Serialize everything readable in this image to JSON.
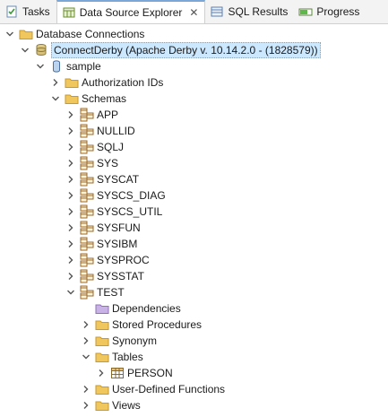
{
  "tabs": [
    {
      "label": "Tasks",
      "icon": "tasks-icon"
    },
    {
      "label": "Data Source Explorer",
      "icon": "data-source-explorer-icon",
      "active": true
    },
    {
      "label": "SQL Results",
      "icon": "sql-results-icon"
    },
    {
      "label": "Progress",
      "icon": "progress-icon"
    }
  ],
  "tree": [
    {
      "label": "Database Connections",
      "level": 0,
      "twisty": "expanded",
      "icon": "folder-icon"
    },
    {
      "label": "ConnectDerby (Apache Derby v. 10.14.2.0 - (1828579))",
      "level": 1,
      "twisty": "expanded",
      "icon": "database-icon",
      "selected": true
    },
    {
      "label": "sample",
      "level": 2,
      "twisty": "expanded",
      "icon": "database-small-icon"
    },
    {
      "label": "Authorization IDs",
      "level": 3,
      "twisty": "collapsed",
      "icon": "folder-icon"
    },
    {
      "label": "Schemas",
      "level": 3,
      "twisty": "expanded",
      "icon": "folder-icon"
    },
    {
      "label": "APP",
      "level": 4,
      "twisty": "collapsed",
      "icon": "schema-icon"
    },
    {
      "label": "NULLID",
      "level": 4,
      "twisty": "collapsed",
      "icon": "schema-icon"
    },
    {
      "label": "SQLJ",
      "level": 4,
      "twisty": "collapsed",
      "icon": "schema-icon"
    },
    {
      "label": "SYS",
      "level": 4,
      "twisty": "collapsed",
      "icon": "schema-icon"
    },
    {
      "label": "SYSCAT",
      "level": 4,
      "twisty": "collapsed",
      "icon": "schema-icon"
    },
    {
      "label": "SYSCS_DIAG",
      "level": 4,
      "twisty": "collapsed",
      "icon": "schema-icon"
    },
    {
      "label": "SYSCS_UTIL",
      "level": 4,
      "twisty": "collapsed",
      "icon": "schema-icon"
    },
    {
      "label": "SYSFUN",
      "level": 4,
      "twisty": "collapsed",
      "icon": "schema-icon"
    },
    {
      "label": "SYSIBM",
      "level": 4,
      "twisty": "collapsed",
      "icon": "schema-icon"
    },
    {
      "label": "SYSPROC",
      "level": 4,
      "twisty": "collapsed",
      "icon": "schema-icon"
    },
    {
      "label": "SYSSTAT",
      "level": 4,
      "twisty": "collapsed",
      "icon": "schema-icon"
    },
    {
      "label": "TEST",
      "level": 4,
      "twisty": "expanded",
      "icon": "schema-icon"
    },
    {
      "label": "Dependencies",
      "level": 5,
      "twisty": "none",
      "icon": "purple-folder-icon"
    },
    {
      "label": "Stored Procedures",
      "level": 5,
      "twisty": "collapsed",
      "icon": "folder-icon"
    },
    {
      "label": "Synonym",
      "level": 5,
      "twisty": "collapsed",
      "icon": "folder-icon"
    },
    {
      "label": "Tables",
      "level": 5,
      "twisty": "expanded",
      "icon": "folder-icon"
    },
    {
      "label": "PERSON",
      "level": 6,
      "twisty": "collapsed",
      "icon": "table-icon"
    },
    {
      "label": "User-Defined Functions",
      "level": 5,
      "twisty": "collapsed",
      "icon": "folder-icon"
    },
    {
      "label": "Views",
      "level": 5,
      "twisty": "collapsed",
      "icon": "folder-icon"
    }
  ],
  "colors": {
    "folder": "#f0c75e",
    "folder_border": "#c89a2a",
    "purple_folder": "#c9b3e6",
    "selection": "#cce8ff",
    "twisty": "#555555"
  }
}
